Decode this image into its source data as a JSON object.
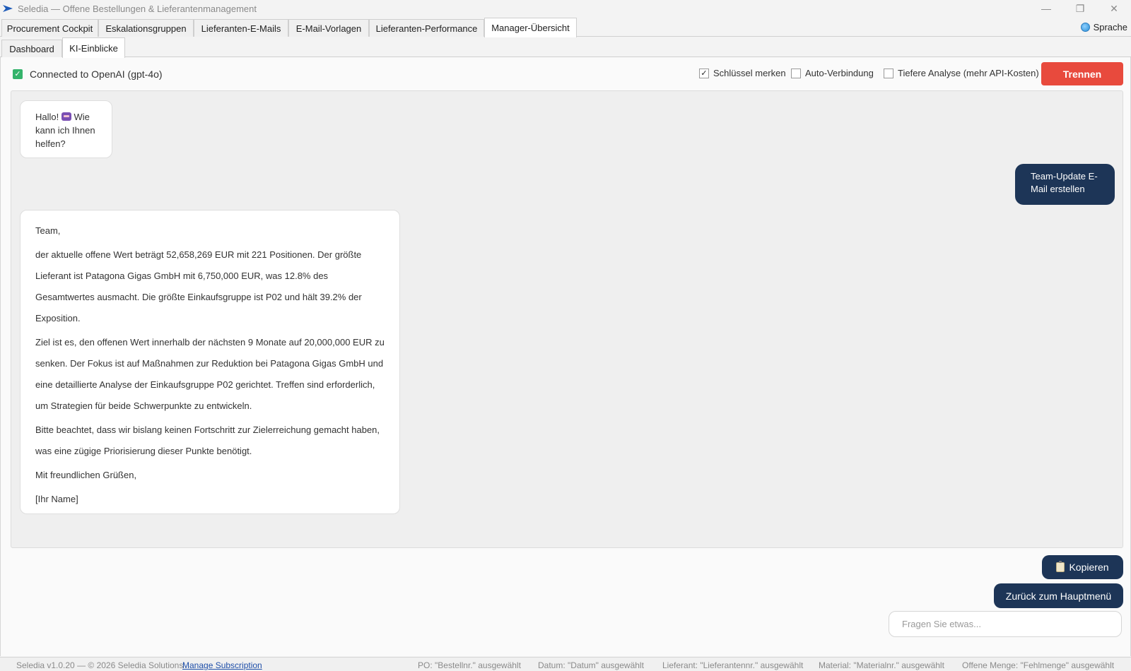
{
  "window": {
    "title": "Seledia — Offene Bestellungen & Lieferantenmanagement",
    "minimize": "—",
    "maximize": "❐",
    "close": "✕"
  },
  "main_tabs": [
    {
      "label": "Procurement Cockpit"
    },
    {
      "label": "Eskalationsgruppen"
    },
    {
      "label": "Lieferanten-E-Mails"
    },
    {
      "label": "E-Mail-Vorlagen"
    },
    {
      "label": "Lieferanten-Performance"
    },
    {
      "label": "Manager-Übersicht",
      "active": true
    }
  ],
  "language_label": "Sprache",
  "sub_tabs": [
    {
      "label": "Dashboard"
    },
    {
      "label": "KI-Einblicke",
      "active": true
    }
  ],
  "connection": {
    "status": "Connected to OpenAI (gpt-4o)",
    "check_glyph": "✓"
  },
  "options": {
    "remember_key": {
      "label": "Schlüssel merken",
      "checked": true,
      "glyph": "✓"
    },
    "auto_connect": {
      "label": "Auto-Verbindung",
      "checked": false
    },
    "deep_analysis": {
      "label": "Tiefere Analyse (mehr API-Kosten)",
      "checked": false
    }
  },
  "disconnect_label": "Trennen",
  "chat": {
    "greeting_before": "Hallo!",
    "greeting_after": "Wie kann ich Ihnen helfen?",
    "user_message": "Team-Update E-Mail erstellen",
    "reply": [
      "Team,",
      "der aktuelle offene Wert beträgt 52,658,269 EUR mit 221 Positionen. Der größte Lieferant ist Patagona Gigas GmbH mit 6,750,000 EUR, was 12.8% des Gesamtwertes ausmacht. Die größte Einkaufsgruppe ist P02 und hält 39.2% der Exposition.",
      "Ziel ist es, den offenen Wert innerhalb der nächsten 9 Monate auf 20,000,000 EUR zu senken. Der Fokus ist auf Maßnahmen zur Reduktion bei Patagona Gigas GmbH und eine detaillierte Analyse der Einkaufsgruppe P02 gerichtet. Treffen sind erforderlich, um Strategien für beide Schwerpunkte zu entwickeln.",
      "Bitte beachtet, dass wir bislang keinen Fortschritt zur Zielerreichung gemacht haben, was eine zügige Priorisierung dieser Punkte benötigt.",
      "Mit freundlichen Grüßen,",
      "[Ihr Name]"
    ]
  },
  "copy_label": "Kopieren",
  "back_label": "Zurück zum Hauptmenü",
  "ask": {
    "placeholder": "Fragen Sie etwas...",
    "value": ""
  },
  "footer": {
    "version": "Seledia v1.0.20 — © 2026 Seledia Solutions",
    "manage_link": "Manage Subscription",
    "po": "PO: \"Bestellnr.\" ausgewählt",
    "date": "Datum: \"Datum\" ausgewählt",
    "supplier": "Lieferant: \"Lieferantennr.\" ausgewählt",
    "material": "Material: \"Materialnr.\" ausgewählt",
    "open_qty": "Offene Menge: \"Fehlmenge\" ausgewählt"
  },
  "colors": {
    "accent_navy": "#1d3557",
    "danger_red": "#e84a3d",
    "success_green": "#34b36b",
    "link_blue": "#1e4ea8"
  },
  "icons": {
    "app_logo": "seledia-logo-icon",
    "language": "globe-icon",
    "greeting_emoji": "robot-emoji-icon",
    "copy": "clipboard-icon"
  }
}
